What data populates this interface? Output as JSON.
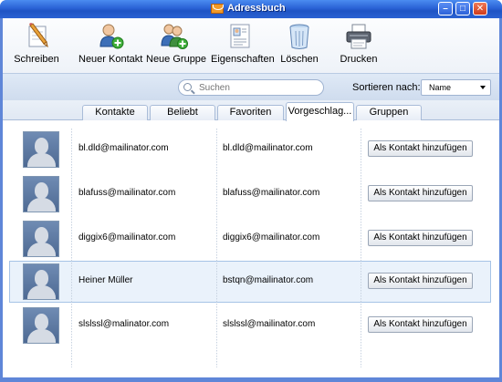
{
  "window": {
    "title": "Adressbuch",
    "buttons": {
      "minimize": "–",
      "maximize": "□",
      "close": "✕"
    }
  },
  "toolbar": {
    "items": [
      {
        "label": "Schreiben",
        "icon": "pencil-paper-icon"
      },
      {
        "label": "Neuer Kontakt",
        "icon": "add-contact-icon"
      },
      {
        "label": "Neue Gruppe",
        "icon": "add-group-icon"
      },
      {
        "label": "Eigenschaften",
        "icon": "contact-card-icon"
      },
      {
        "label": "Löschen",
        "icon": "trash-icon"
      },
      {
        "label": "Drucken",
        "icon": "printer-icon"
      }
    ]
  },
  "search": {
    "placeholder": "Suchen"
  },
  "sort": {
    "label": "Sortieren nach:",
    "value": "Name"
  },
  "tabs": [
    {
      "label": "Kontakte",
      "active": false
    },
    {
      "label": "Beliebt",
      "active": false
    },
    {
      "label": "Favoriten",
      "active": false
    },
    {
      "label": "Vorgeschlag...",
      "active": true
    },
    {
      "label": "Gruppen",
      "active": false
    }
  ],
  "contacts": [
    {
      "name": "bl.dld@mailinator.com",
      "email": "bl.dld@mailinator.com",
      "action": "Als Kontakt hinzufügen",
      "selected": false
    },
    {
      "name": "blafuss@mailinator.com",
      "email": "blafuss@mailinator.com",
      "action": "Als Kontakt hinzufügen",
      "selected": false
    },
    {
      "name": "diggix6@mailinator.com",
      "email": "diggix6@mailinator.com",
      "action": "Als Kontakt hinzufügen",
      "selected": false
    },
    {
      "name": "Heiner Müller",
      "email": "bstqn@mailinator.com",
      "action": "Als Kontakt hinzufügen",
      "selected": true
    },
    {
      "name": "slslssl@malinator.com",
      "email": "slslssl@mailinator.com",
      "action": "Als Kontakt hinzufügen",
      "selected": false
    }
  ],
  "colors": {
    "titlebar": "#2a63d6",
    "selection": "#eaf2fb",
    "toolbar_bg": "#eef2f8"
  }
}
